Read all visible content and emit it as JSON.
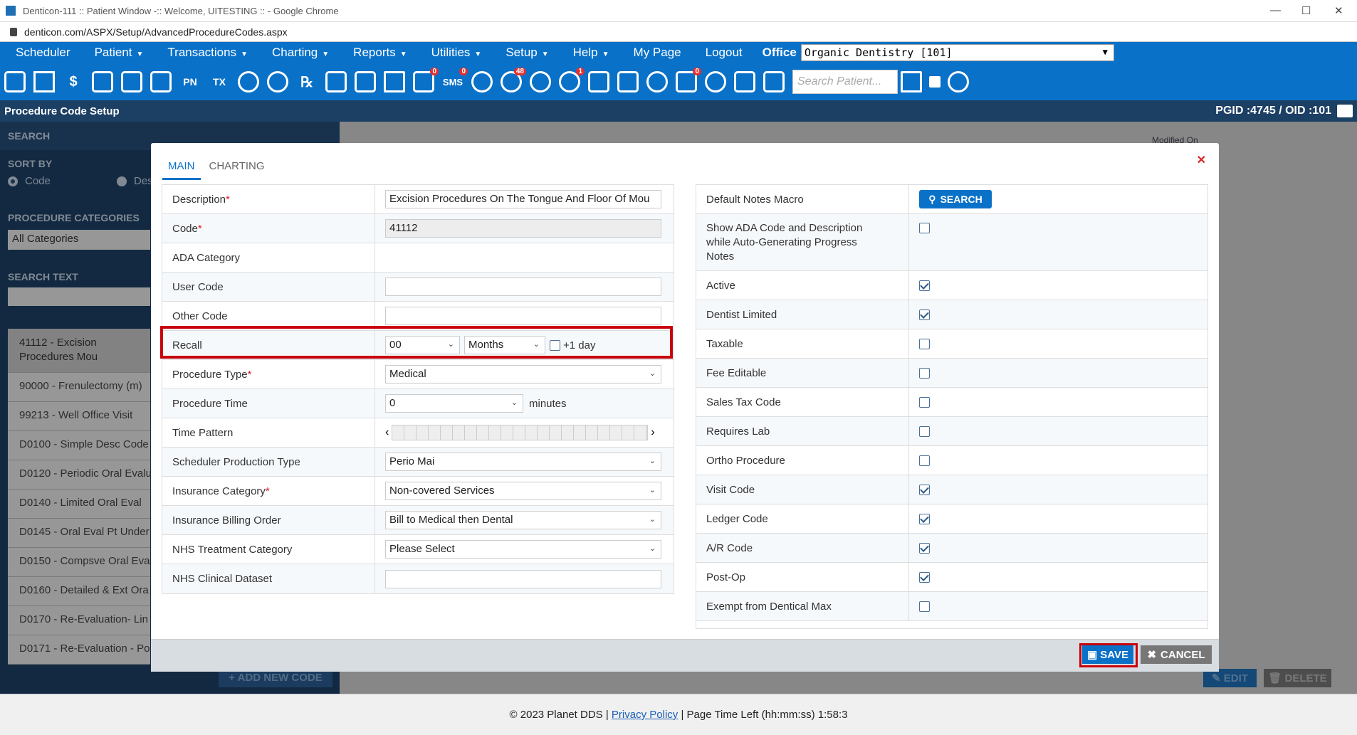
{
  "browser": {
    "window_title": "Denticon-111 :: Patient Window -:: Welcome, UITESTING :: - Google Chrome",
    "url": "denticon.com/ASPX/Setup/AdvancedProcedureCodes.aspx"
  },
  "menu": {
    "items": [
      "Scheduler",
      "Patient",
      "Transactions",
      "Charting",
      "Reports",
      "Utilities",
      "Setup",
      "Help",
      "My Page",
      "Logout"
    ],
    "office_label": "Office",
    "office_value": "Organic Dentistry [101]"
  },
  "toolbar": {
    "search_placeholder": "Search Patient...",
    "badges": [
      "0",
      "0",
      "48",
      "1",
      "0"
    ],
    "labels": [
      "PN",
      "TX",
      "SMS"
    ]
  },
  "page_header": {
    "title": "Procedure Code Setup",
    "ids": "PGID :4745 / OID :101"
  },
  "sidebar": {
    "search_header": "SEARCH",
    "sort_by_label": "SORT BY",
    "sort_code": "Code",
    "sort_desc": "Des",
    "categories_label": "PROCEDURE CATEGORIES",
    "categories_value": "All Categories",
    "search_text_label": "SEARCH TEXT",
    "codes": [
      "41112 - Excision Procedures Mou",
      "90000 - Frenulectomy (m)",
      "99213 - Well Office Visit",
      "D0100 - Simple Desc Code",
      "D0120 - Periodic Oral Evalu",
      "D0140 - Limited Oral Eval",
      "D0145 - Oral Eval Pt Under",
      "D0150 - Compsve Oral Eva",
      "D0160 - Detailed & Ext Ora",
      "D0170 - Re-Evaluation- Lin",
      "D0171 - Re-Evaluation - Po"
    ],
    "add_new_code": "ADD NEW CODE"
  },
  "background": {
    "modified_on": "Modified On",
    "edit": "EDIT",
    "delete": "DELETE"
  },
  "modal": {
    "tabs": [
      "MAIN",
      "CHARTING"
    ],
    "left_fields": {
      "description_label": "Description",
      "description_value": "Excision Procedures On The Tongue And Floor Of Mou",
      "code_label": "Code",
      "code_value": "41112",
      "ada_category_label": "ADA Category",
      "user_code_label": "User Code",
      "other_code_label": "Other Code",
      "recall_label": "Recall",
      "recall_value": "00",
      "recall_unit": "Months",
      "recall_plus_day": "+1 day",
      "procedure_type_label": "Procedure Type",
      "procedure_type_value": "Medical",
      "procedure_time_label": "Procedure Time",
      "procedure_time_value": "0",
      "procedure_time_unit": "minutes",
      "time_pattern_label": "Time Pattern",
      "scheduler_production_type_label": "Scheduler Production Type",
      "scheduler_production_type_value": "Perio Mai",
      "insurance_category_label": "Insurance Category",
      "insurance_category_value": "Non-covered Services",
      "insurance_billing_order_label": "Insurance Billing Order",
      "insurance_billing_order_value": "Bill to Medical then Dental",
      "nhs_treatment_category_label": "NHS Treatment Category",
      "nhs_treatment_category_value": "Please Select",
      "nhs_clinical_dataset_label": "NHS Clinical Dataset"
    },
    "right_fields": [
      {
        "label": "Default Notes Macro",
        "type": "button",
        "button": "SEARCH"
      },
      {
        "label": "Show ADA Code and Description while Auto-Generating Progress Notes",
        "checked": false
      },
      {
        "label": "Active",
        "checked": true
      },
      {
        "label": "Dentist Limited",
        "checked": true
      },
      {
        "label": "Taxable",
        "checked": false
      },
      {
        "label": "Fee Editable",
        "checked": false
      },
      {
        "label": "Sales Tax Code",
        "checked": false
      },
      {
        "label": "Requires Lab",
        "checked": false
      },
      {
        "label": "Ortho Procedure",
        "checked": false
      },
      {
        "label": "Visit Code",
        "checked": true
      },
      {
        "label": "Ledger Code",
        "checked": true
      },
      {
        "label": "A/R Code",
        "checked": true
      },
      {
        "label": "Post-Op",
        "checked": true
      },
      {
        "label": "Exempt from Dentical Max",
        "checked": false
      }
    ],
    "save": "SAVE",
    "cancel": "CANCEL"
  },
  "footer": {
    "copyright": "© 2023 Planet DDS |",
    "privacy": "Privacy Policy",
    "time_left": "| Page Time Left (hh:mm:ss) 1:58:3"
  }
}
